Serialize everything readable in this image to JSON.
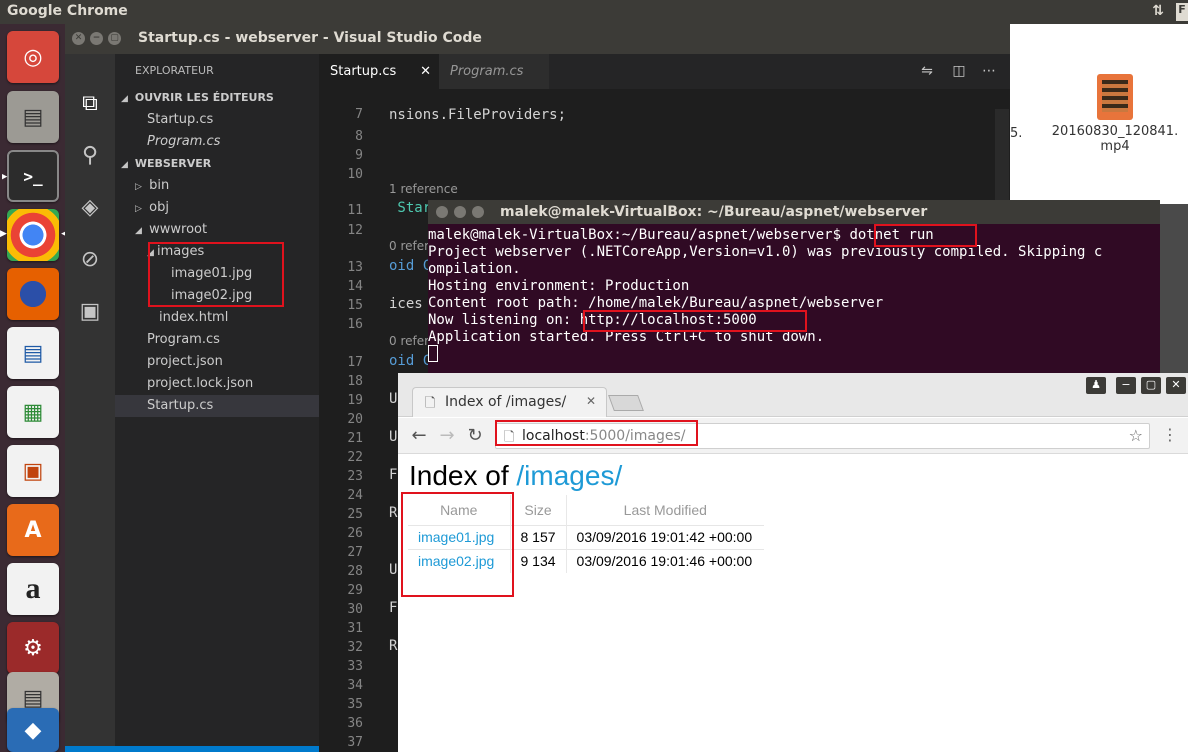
{
  "top_panel": {
    "app_name": "Google Chrome",
    "indicator": "F"
  },
  "launcher": {
    "items": [
      "ubuntu-dash",
      "files",
      "terminal",
      "chrome",
      "firefox",
      "libreoffice-writer",
      "libreoffice-calc",
      "libreoffice-impress",
      "software-center",
      "amazon",
      "system-settings",
      "files-2",
      "virtualbox"
    ]
  },
  "desktop": {
    "file_name": "20160830_120841.mp4",
    "file_name_line1": "20160830_120841.",
    "file_name_line2": "mp4",
    "partial_label": "5."
  },
  "vscode": {
    "window_title": "Startup.cs - webserver - Visual Studio Code",
    "explorer_header": "EXPLORATEUR",
    "open_editors_header": "OUVRIR LES ÉDITEURS",
    "open_editors": [
      "Startup.cs",
      "Program.cs"
    ],
    "project_header": "WEBSERVER",
    "tree": {
      "bin": "bin",
      "obj": "obj",
      "wwwroot": "wwwroot",
      "images": "images",
      "image01": "image01.jpg",
      "image02": "image02.jpg",
      "index": "index.html",
      "program": "Program.cs",
      "project_json": "project.json",
      "project_lock": "project.lock.json",
      "startup": "Startup.cs"
    },
    "tabs": {
      "active": "Startup.cs",
      "inactive": "Program.cs"
    },
    "line_numbers": [
      "7",
      "8",
      "9",
      "10",
      "11",
      "12",
      "13",
      "14",
      "15",
      "16",
      "17",
      "18",
      "19",
      "20",
      "21",
      "22",
      "23",
      "24",
      "25",
      "26",
      "27",
      "28",
      "29",
      "30",
      "31",
      "32",
      "33",
      "34",
      "35",
      "36",
      "37"
    ],
    "code": {
      "line7": "nsions.FileProviders;",
      "ref1": "1 reference",
      "line11": " Startup",
      "ref2": "0 refer",
      "line13": "oid C",
      "line15": "ices",
      "ref3": "0 refer",
      "line17": "oid C",
      "line19": "U",
      "line21": "U",
      "line23": "F",
      "line25": "R",
      "line28": "U",
      "line30": "F",
      "line32": "R"
    }
  },
  "terminal": {
    "window_title": "malek@malek-VirtualBox: ~/Bureau/aspnet/webserver",
    "prompt": "malek@malek-VirtualBox:~/Bureau/aspnet/webserver$ ",
    "command": "dotnet run",
    "line2": "Project webserver (.NETCoreApp,Version=v1.0) was previously compiled. Skipping c",
    "line3": "ompilation.",
    "line4": "Hosting environment: Production",
    "line5": "Content root path: /home/malek/Bureau/aspnet/webserver",
    "line6_prefix": "Now listening on: ",
    "listen_url": "http://localhost:5000",
    "line7": "Application started. Press Ctrl+C to shut down."
  },
  "chrome": {
    "tab_title": "Index of /images/",
    "url_host": "localhost",
    "url_rest": ":5000/images/",
    "page": {
      "heading_prefix": "Index of ",
      "heading_link": "/images/",
      "columns": {
        "name": "Name",
        "size": "Size",
        "modified": "Last Modified"
      },
      "rows": [
        {
          "name": "image01.jpg",
          "size": "8 157",
          "modified": "03/09/2016 19:01:42 +00:00"
        },
        {
          "name": "image02.jpg",
          "size": "9 134",
          "modified": "03/09/2016 19:01:46 +00:00"
        }
      ]
    }
  },
  "colors": {
    "annotation_red": "#e0121d",
    "link_blue": "#1e9ad6",
    "terminal_bg": "#300a24",
    "vscode_bg": "#1e1e1e"
  }
}
